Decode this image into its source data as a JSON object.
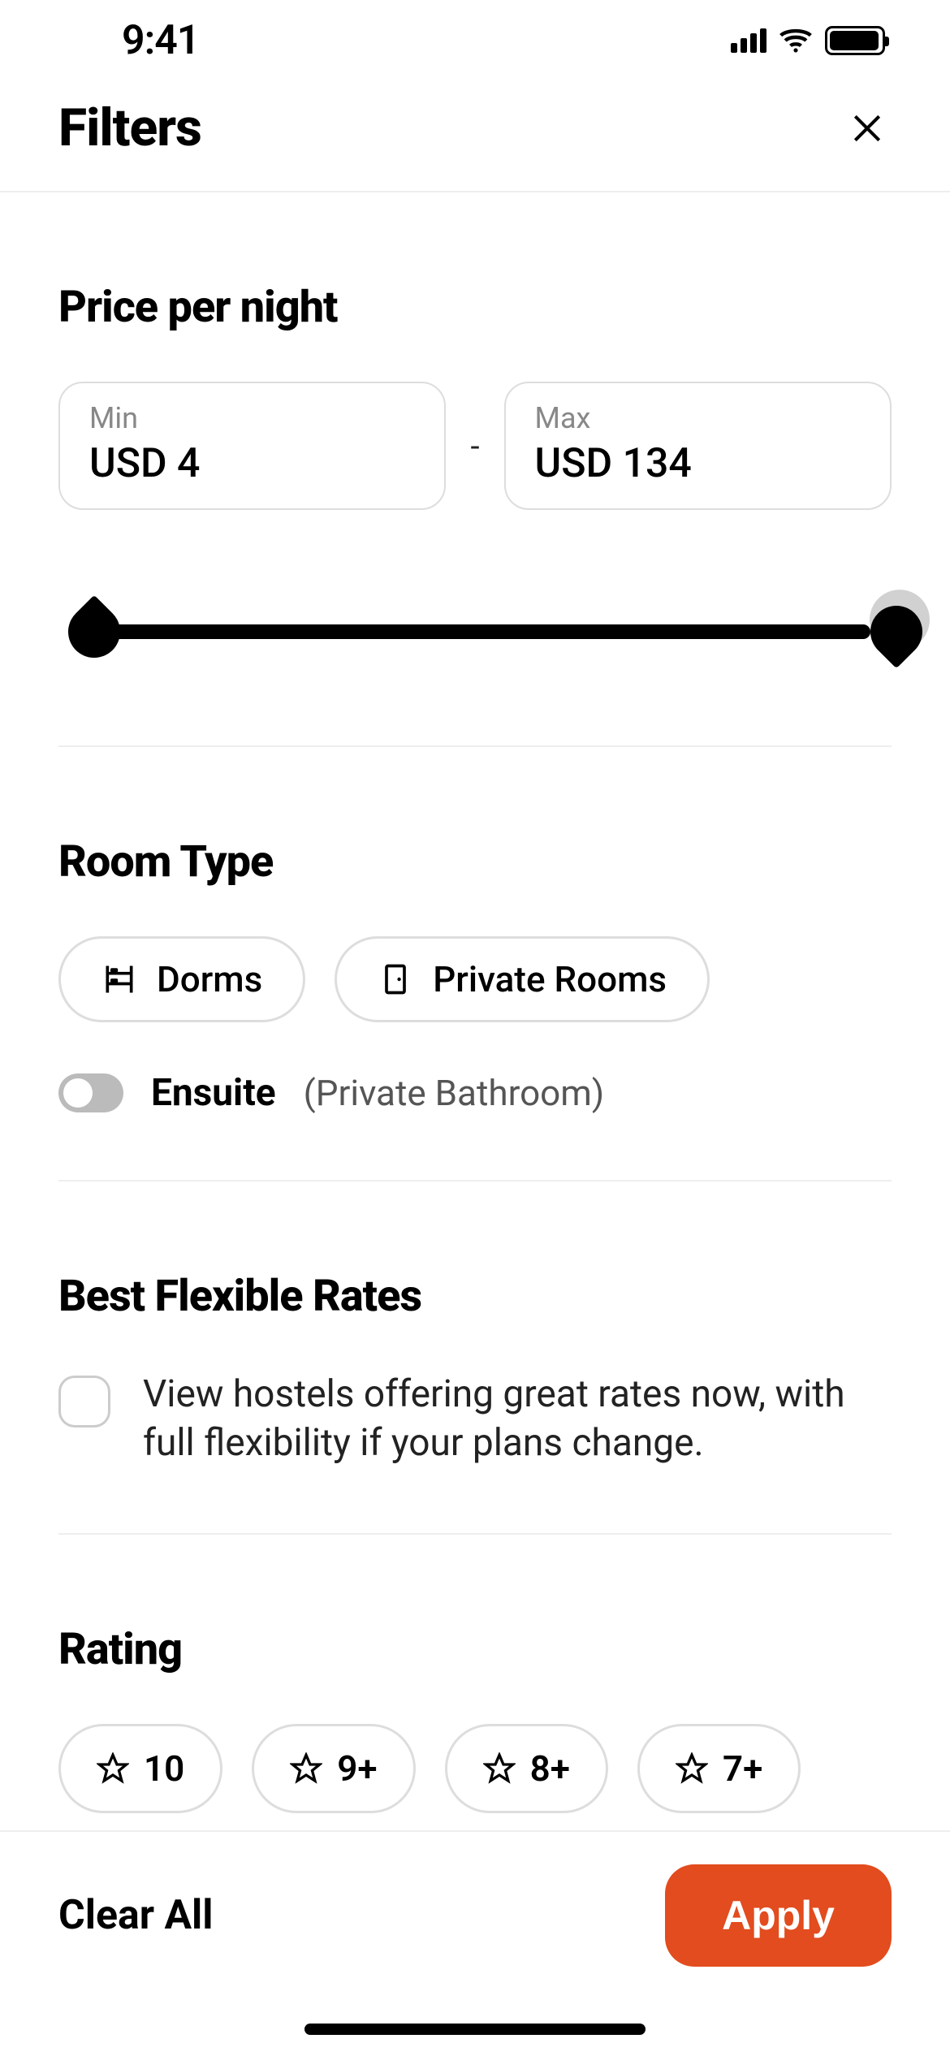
{
  "status": {
    "time": "9:41"
  },
  "header": {
    "title": "Filters"
  },
  "price": {
    "title": "Price per night",
    "min_label": "Min",
    "min_value": "USD 4",
    "max_label": "Max",
    "max_value": "USD 134",
    "separator": "-"
  },
  "room_type": {
    "title": "Room Type",
    "options": [
      {
        "label": "Dorms",
        "icon": "bunk-bed-icon"
      },
      {
        "label": "Private Rooms",
        "icon": "door-icon"
      }
    ],
    "ensuite": {
      "label": "Ensuite",
      "sub": "(Private Bathroom)",
      "enabled": false
    }
  },
  "flexible": {
    "title": "Best Flexible Rates",
    "description": "View hostels offering great rates now, with full flexibility if your plans change.",
    "checked": false
  },
  "rating": {
    "title": "Rating",
    "options": [
      "10",
      "9+",
      "8+",
      "7+"
    ]
  },
  "footer": {
    "clear": "Clear All",
    "apply": "Apply"
  }
}
